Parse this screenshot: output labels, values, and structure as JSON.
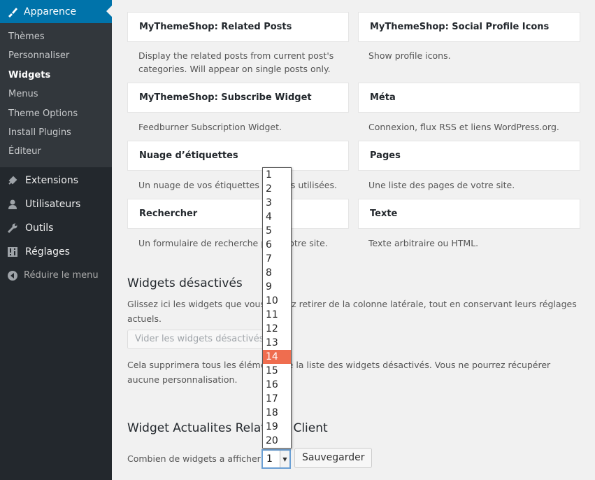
{
  "sidebar": {
    "current": {
      "label": "Apparence",
      "icon": "paintbrush-icon"
    },
    "submenu": [
      "Thèmes",
      "Personnaliser",
      "Widgets",
      "Menus",
      "Theme Options",
      "Install Plugins",
      "Éditeur"
    ],
    "items": [
      {
        "label": "Extensions",
        "icon": "plugin-icon"
      },
      {
        "label": "Utilisateurs",
        "icon": "users-icon"
      },
      {
        "label": "Outils",
        "icon": "wrench-icon"
      },
      {
        "label": "Réglages",
        "icon": "settings-icon"
      }
    ],
    "collapse": "Réduire le menu",
    "colors": {
      "bg": "#23282d",
      "accent": "#0073aa",
      "submenu_bg": "#32373c"
    }
  },
  "widgets": [
    {
      "title": "MyThemeShop: Related Posts",
      "desc": "Display the related posts from current post's categories. Will appear on single posts only."
    },
    {
      "title": "MyThemeShop: Social Profile Icons",
      "desc": "Show profile icons."
    },
    {
      "title": "MyThemeShop: Subscribe Widget",
      "desc": "Feedburner Subscription Widget."
    },
    {
      "title": "Méta",
      "desc": "Connexion, flux RSS et liens WordPress.org."
    },
    {
      "title": "Nuage d’étiquettes",
      "desc": "Un nuage de vos étiquettes les plus utilisées."
    },
    {
      "title": "Pages",
      "desc": "Une liste des pages de votre site."
    },
    {
      "title": "Rechercher",
      "desc": "Un formulaire de recherche pour votre site."
    },
    {
      "title": "Texte",
      "desc": "Texte arbitraire ou HTML."
    }
  ],
  "inactive": {
    "title": "Widgets désactivés",
    "desc": "Glissez ici les widgets que vous voulez retirer de la colonne latérale, tout en conservant leurs réglages actuels.",
    "clear_button": "Vider les widgets désactivés",
    "note": "Cela supprimera tous les éléments de la liste des widgets désactivés. Vous ne pourrez récupérer aucune personnalisation."
  },
  "related": {
    "title": "Widget Actualites Relatives Client",
    "count_label": "Combien de widgets a afficher ?",
    "selected": "1",
    "highlighted": "14",
    "options": [
      "1",
      "2",
      "3",
      "4",
      "5",
      "6",
      "7",
      "8",
      "9",
      "10",
      "11",
      "12",
      "13",
      "14",
      "15",
      "16",
      "17",
      "18",
      "19",
      "20"
    ],
    "save_button": "Sauvegarder",
    "highlight_color": "#ef6d4f"
  }
}
